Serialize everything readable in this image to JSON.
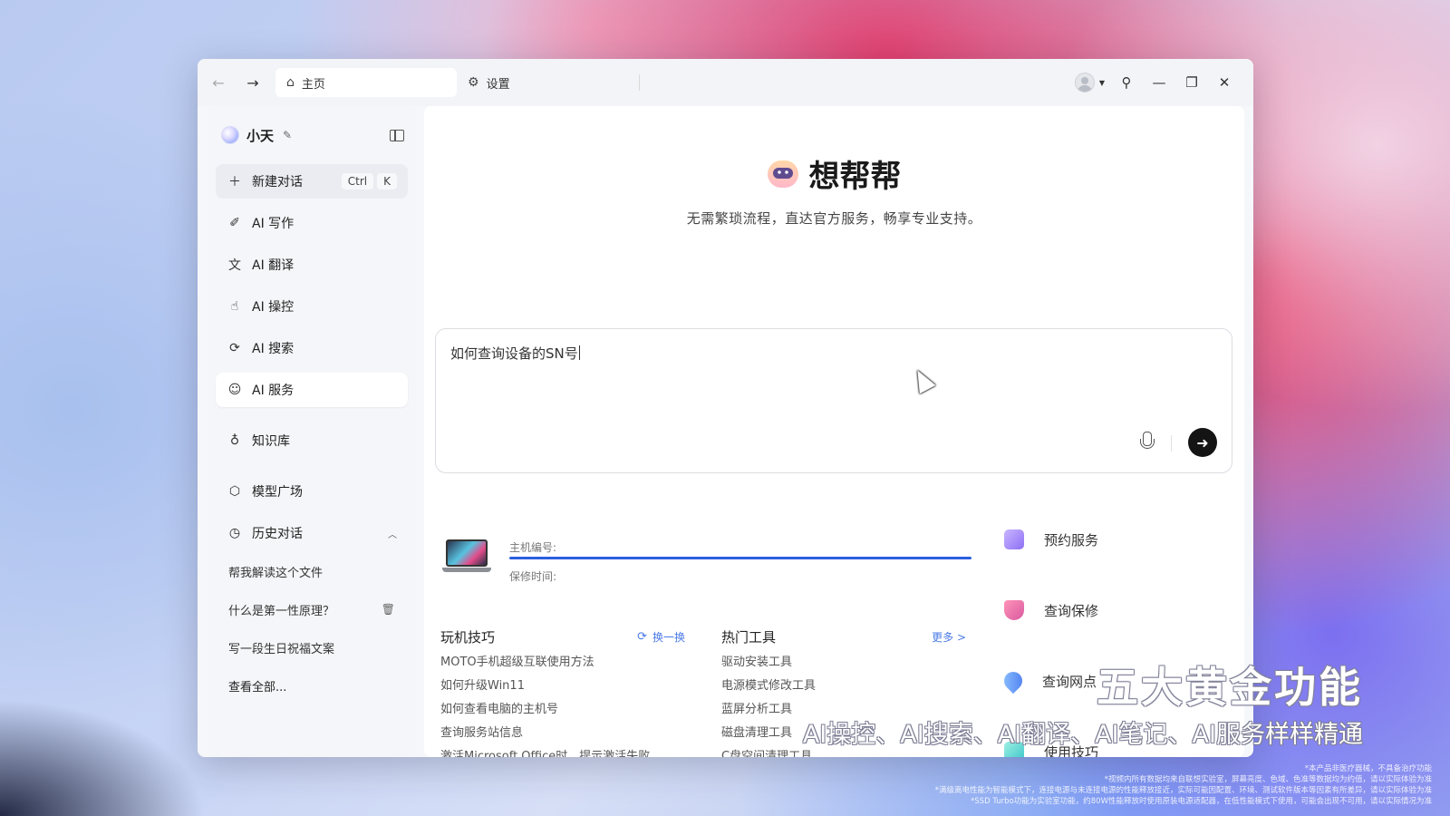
{
  "titlebar": {
    "tabs": [
      {
        "label": "主页",
        "icon": "home-icon"
      },
      {
        "label": "设置",
        "icon": "gear-icon"
      }
    ]
  },
  "sidebar": {
    "title": "小天",
    "new_chat": {
      "label": "新建对话",
      "keys": [
        "Ctrl",
        "K"
      ]
    },
    "items": [
      {
        "label": "AI 写作",
        "icon": "pen-icon"
      },
      {
        "label": "AI 翻译",
        "icon": "translate-icon"
      },
      {
        "label": "AI 操控",
        "icon": "control-icon"
      },
      {
        "label": "AI 搜索",
        "icon": "search-icon"
      },
      {
        "label": "AI 服务",
        "icon": "service-icon"
      }
    ],
    "knowledge": "知识库",
    "models": "模型广场",
    "history": {
      "title": "历史对话",
      "items": [
        "帮我解读这个文件",
        "什么是第一性原理？",
        "写一段生日祝福文案"
      ],
      "view_all": "查看全部..."
    }
  },
  "main": {
    "title": "想帮帮",
    "subtitle": "无需繁琐流程，直达官方服务，畅享专业支持。",
    "input": {
      "value": "如何查询设备的SN号"
    },
    "device": {
      "serial_label": "主机编号:",
      "warranty_label": "保修时间:"
    },
    "tips": {
      "title": "玩机技巧",
      "action": "换一换",
      "items": [
        "MOTO手机超级互联使用方法",
        "如何升级Win11",
        "如何查看电脑的主机号",
        "查询服务站信息",
        "激活Microsoft Office时，提示激活失败"
      ]
    },
    "tools": {
      "title": "热门工具",
      "action": "更多 >",
      "items": [
        "驱动安装工具",
        "电源模式修改工具",
        "蓝屏分析工具",
        "磁盘清理工具",
        "C盘空间清理工具"
      ]
    },
    "services": [
      {
        "label": "预约服务",
        "icon": "calendar-icon"
      },
      {
        "label": "查询保修",
        "icon": "shield-icon"
      },
      {
        "label": "查询网点",
        "icon": "location-icon"
      },
      {
        "label": "使用技巧",
        "icon": "tips-icon"
      }
    ]
  },
  "overlay": {
    "title": "五大黄金功能",
    "subtitle": "AI操控、AI搜索、AI翻译、AI笔记、AI服务样样精通",
    "disclaimer": [
      "*本产品非医疗器械，不具备治疗功能",
      "*视频内所有数据均来自联想实验室，屏幕亮度、色域、色准等数据均为约值，请以实际体验为准",
      "*满级离电性能为智能模式下，连接电源与未连接电源的性能释放接近，实际可能因配置、环境、测试软件版本等因素有所差异，请以实际体验为准",
      "*SSD Turbo功能为实验室功能，约80W性能释放时使用原装电源适配器，在低性能模式下使用，可能会出现不可用，请以实际情况为准"
    ]
  },
  "colors": {
    "accent": "#2b5fe0",
    "link": "#4a7ae6",
    "send_button": "#141414"
  }
}
